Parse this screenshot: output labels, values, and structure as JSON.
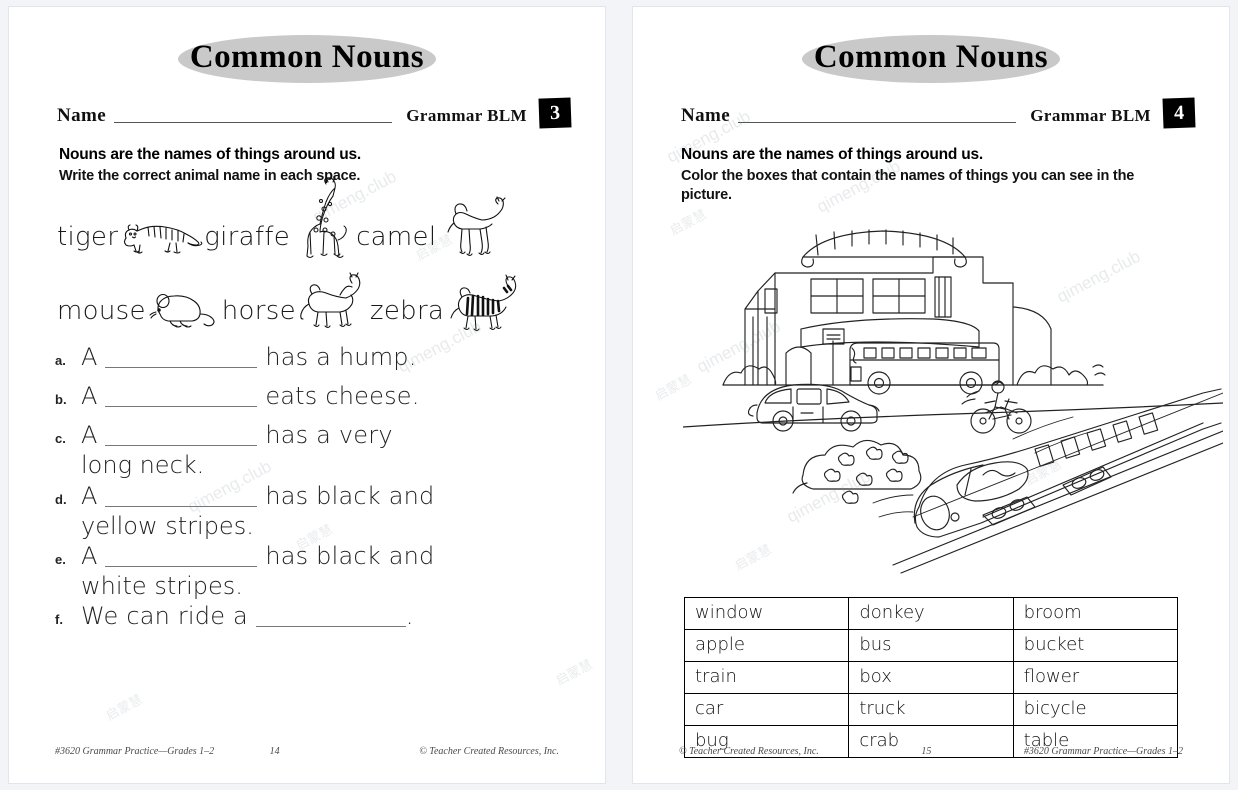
{
  "watermark": {
    "latin": "qimeng.club",
    "cjk": "启蒙慧"
  },
  "pages": [
    {
      "title": "Common Nouns",
      "name_label": "Name",
      "blm_label": "Grammar BLM",
      "blm_number": "3",
      "instruction_bold": "Nouns are the names of things around us.",
      "instruction_sub": "Write the correct animal name in each space.",
      "word_bank": [
        [
          {
            "word": "tiger",
            "picture": "tiger-illustration"
          },
          {
            "word": "giraffe",
            "picture": "giraffe-illustration"
          },
          {
            "word": "camel",
            "picture": "camel-illustration"
          }
        ],
        [
          {
            "word": "mouse",
            "picture": "mouse-illustration"
          },
          {
            "word": "horse",
            "picture": "horse-illustration"
          },
          {
            "word": "zebra",
            "picture": "zebra-illustration"
          }
        ]
      ],
      "questions": [
        {
          "letter": "a.",
          "before": "A",
          "after": "has a hump.",
          "second_line": ""
        },
        {
          "letter": "b.",
          "before": "A",
          "after": "eats cheese.",
          "second_line": ""
        },
        {
          "letter": "c.",
          "before": "A",
          "after": "has a very",
          "second_line": "long neck."
        },
        {
          "letter": "d.",
          "before": "A",
          "after": "has black and",
          "second_line": "yellow stripes."
        },
        {
          "letter": "e.",
          "before": "A",
          "after": "has black and",
          "second_line": "white stripes."
        },
        {
          "letter": "f.",
          "before": "We can ride a",
          "after": ".",
          "second_line": ""
        }
      ],
      "footer": {
        "left": "#3620 Grammar Practice—Grades 1–2",
        "center": "14",
        "right": "© Teacher Created Resources, Inc."
      }
    },
    {
      "title": "Common Nouns",
      "name_label": "Name",
      "blm_label": "Grammar BLM",
      "blm_number": "4",
      "instruction_bold": "Nouns are the names of things around us.",
      "instruction_sub": "Color the boxes that contain the names of things you can see in the picture.",
      "illustration": {
        "name": "street-scene-illustration",
        "items": [
          "building",
          "bus",
          "car",
          "motorcycle-rider",
          "bullet-train",
          "flowers",
          "road",
          "railway-track"
        ]
      },
      "word_table": [
        [
          "window",
          "donkey",
          "broom"
        ],
        [
          "apple",
          "bus",
          "bucket"
        ],
        [
          "train",
          "box",
          "flower"
        ],
        [
          "car",
          "truck",
          "bicycle"
        ],
        [
          "bug",
          "crab",
          "table"
        ]
      ],
      "footer": {
        "left": "© Teacher Created Resources, Inc.",
        "center": "15",
        "right": "#3620 Grammar Practice—Grades 1–2"
      }
    }
  ]
}
